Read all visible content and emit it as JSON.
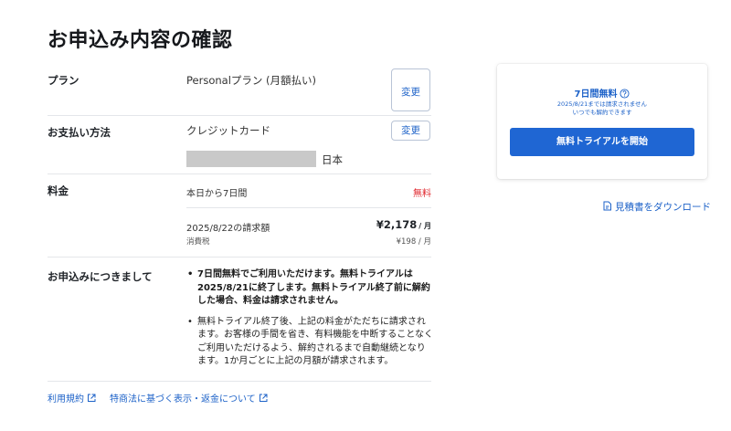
{
  "page": {
    "title": "お申込み内容の確認"
  },
  "plan": {
    "label": "プラン",
    "value": "Personalプラン (月額払い)",
    "change_label": "変更"
  },
  "payment": {
    "label": "お支払い方法",
    "method": "クレジットカード",
    "country": "日本",
    "change_label": "変更"
  },
  "fee": {
    "label": "料金",
    "today_label": "本日から7日間",
    "today_value": "無料",
    "bill_label": "2025/8/22の請求額",
    "bill_amount": "¥2,178",
    "bill_per": "/ 月",
    "tax_label": "消費税",
    "tax_amount": "¥198 / 月"
  },
  "notice": {
    "label": "お申込みにつきまして",
    "items": [
      "7日間無料でご利用いただけます。無料トライアルは2025/8/21に終了します。無料トライアル終了前に解約した場合、料金は請求されません。",
      "無料トライアル終了後、上記の料金がただちに請求されます。お客様の手間を省き、有料機能を中断することなくご利用いただけるよう、解約されるまで自動継続となります。1か月ごとに上記の月額が請求されます。"
    ]
  },
  "footer": {
    "terms_label": "利用規約",
    "law_label": "特商法に基づく表示・返金について"
  },
  "trial_card": {
    "title": "7日間無料",
    "note_line1": "2025/8/21までは請求されません",
    "note_line2": "いつでも解約できます",
    "button_label": "無料トライアルを開始"
  },
  "download": {
    "label": "見積書をダウンロード"
  },
  "colors": {
    "accent": "#1f66d3",
    "link": "#1d62c8",
    "danger": "#e0262d"
  },
  "icons": {
    "external_link": "external-link-icon",
    "help": "help-circle-icon",
    "document": "document-icon"
  }
}
